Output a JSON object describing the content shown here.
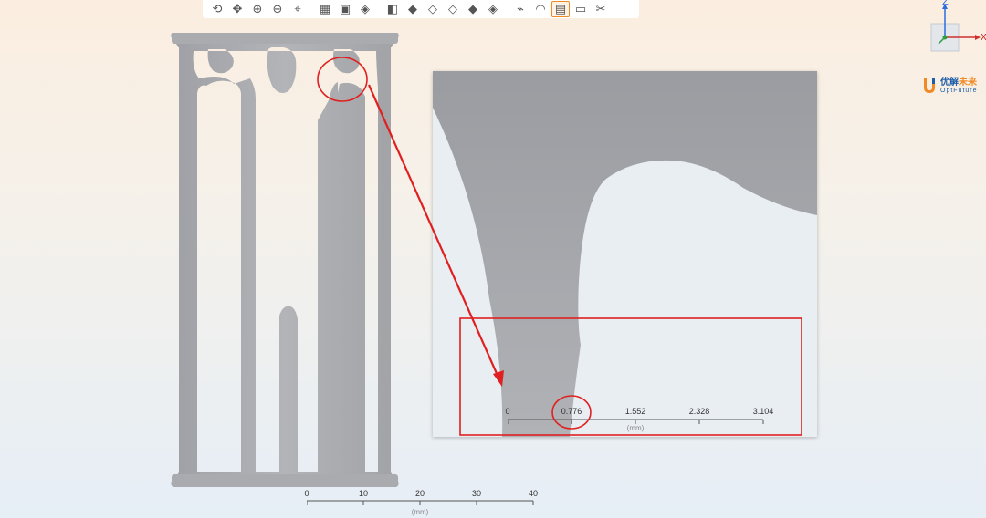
{
  "toolbar": {
    "buttons": [
      {
        "id": "rotate",
        "icon": "rotate-icon",
        "glyph": "⟲"
      },
      {
        "id": "pan",
        "icon": "pan-icon",
        "glyph": "✥"
      },
      {
        "id": "zoom-in",
        "icon": "zoom-in-icon",
        "glyph": "⊕"
      },
      {
        "id": "zoom-out",
        "icon": "zoom-out-icon",
        "glyph": "⊖"
      },
      {
        "id": "zoom-fit",
        "icon": "zoom-fit-icon",
        "glyph": "⌖"
      },
      {
        "id": "select-grid",
        "icon": "select-grid-icon",
        "glyph": "▦"
      },
      {
        "id": "select-play",
        "icon": "select-play-icon",
        "glyph": "▣"
      },
      {
        "id": "view-cube",
        "icon": "view-cube-icon",
        "glyph": "◈"
      },
      {
        "id": "view-front",
        "icon": "view-front-icon",
        "glyph": "◧"
      },
      {
        "id": "view-back",
        "icon": "view-back-icon",
        "glyph": "◆"
      },
      {
        "id": "view-left",
        "icon": "view-left-icon",
        "glyph": "◇"
      },
      {
        "id": "view-right",
        "icon": "view-right-icon",
        "glyph": "◇"
      },
      {
        "id": "view-top",
        "icon": "view-top-icon",
        "glyph": "◆"
      },
      {
        "id": "view-iso",
        "icon": "view-iso-icon",
        "glyph": "◈"
      },
      {
        "id": "pick-point",
        "icon": "pick-point-icon",
        "glyph": "⌁"
      },
      {
        "id": "measure-angle",
        "icon": "measure-angle-icon",
        "glyph": "◠"
      },
      {
        "id": "ruler",
        "icon": "ruler-icon",
        "glyph": "▤",
        "active": true
      },
      {
        "id": "plane",
        "icon": "plane-icon",
        "glyph": "▭"
      },
      {
        "id": "clip",
        "icon": "clip-icon",
        "glyph": "✂"
      }
    ]
  },
  "triad": {
    "z_label": "Z",
    "x_label": "X"
  },
  "logo": {
    "cn_a": "优解",
    "cn_b": "未来",
    "en": "OptFuture"
  },
  "main_scale": {
    "ticks": [
      {
        "label": "0",
        "value": 0
      },
      {
        "label": "10",
        "value": 10
      },
      {
        "label": "20",
        "value": 20
      },
      {
        "label": "30",
        "value": 30
      },
      {
        "label": "40",
        "value": 40
      }
    ],
    "unit": "(mm)"
  },
  "zoom_scale": {
    "ticks": [
      {
        "label": "0",
        "value": 0
      },
      {
        "label": "0.776",
        "value": 0.776
      },
      {
        "label": "1.552",
        "value": 1.552
      },
      {
        "label": "2.328",
        "value": 2.328
      },
      {
        "label": "3.104",
        "value": 3.104
      }
    ],
    "unit": "(mm)"
  },
  "colors": {
    "annotation": "#e02020",
    "part": "#a7a9ae",
    "active_outline": "#f08a24",
    "brand_blue": "#1e5ea8"
  }
}
